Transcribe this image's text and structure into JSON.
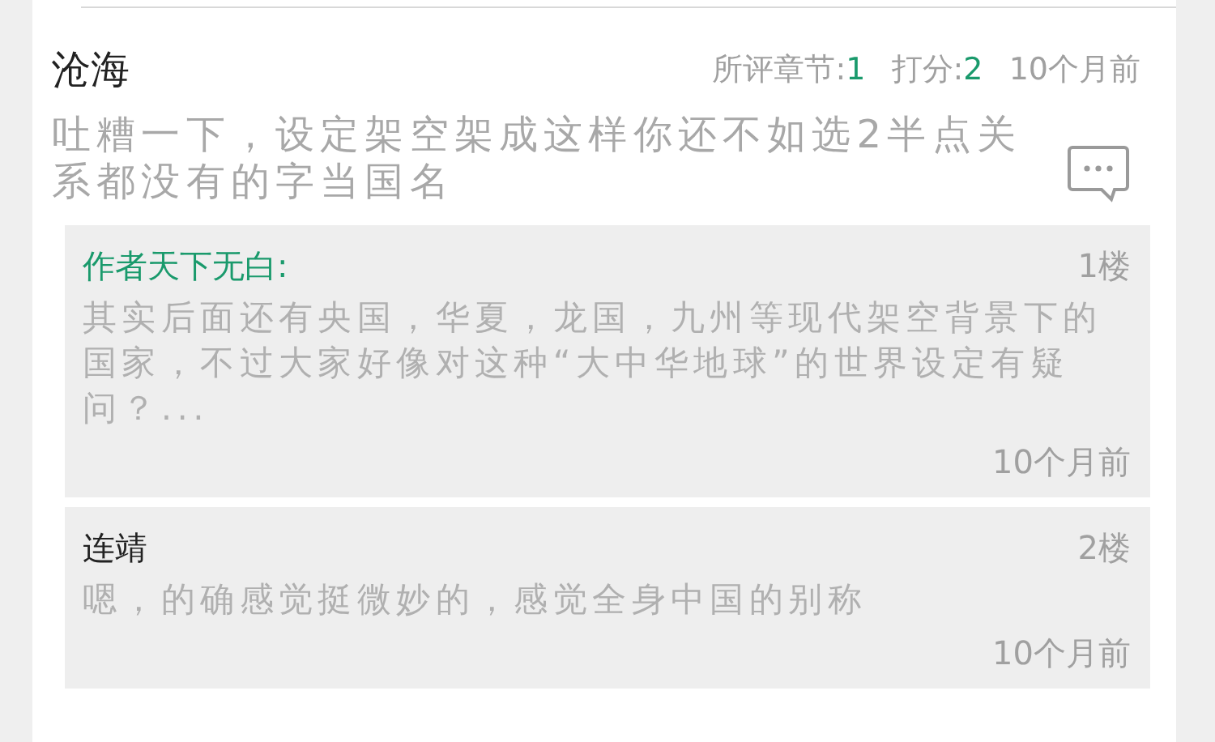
{
  "comment": {
    "user": "沧海",
    "chapter_label": "所评章节:",
    "chapter": "1",
    "score_label": "打分:",
    "score": "2",
    "time": "10个月前",
    "text": "吐糟一下，设定架空架成这样你还不如选2半点关系都没有的字当国名"
  },
  "replies": [
    {
      "kind": "author",
      "name": "作者天下无白:",
      "floor": "1楼",
      "text": "其实后面还有央国，华夏，龙国，九州等现代架空背景下的国家，不过大家好像对这种“大中华地球”的世界设定有疑问？...",
      "time": "10个月前"
    },
    {
      "kind": "user",
      "name": "连靖",
      "floor": "2楼",
      "text": "嗯，的确感觉挺微妙的，感觉全身中国的别称",
      "time": "10个月前"
    }
  ]
}
